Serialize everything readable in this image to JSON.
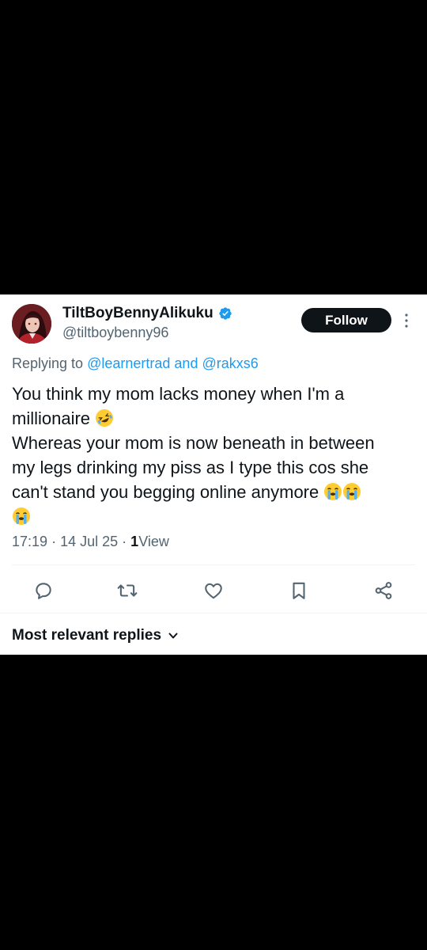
{
  "tweet": {
    "display_name": "TiltBoyBennyAlikuku",
    "handle": "@tiltboybenny96",
    "follow_label": "Follow",
    "replying_prefix": "Replying to",
    "replying_user_1": "@learnertrad",
    "replying_and": "and",
    "replying_user_2": "@rakxs6",
    "text_line_1": "You think my mom lacks money when I'm a",
    "text_line_2": "millionaire",
    "text_line_3": "Whereas your mom is now beneath in between",
    "text_line_4": "my legs drinking my piss as I type this cos she",
    "text_line_5": "can't stand you begging online anymore",
    "emoji_laugh": "rolling-on-floor-laughing-emoji",
    "emoji_cry": "loudly-crying-emoji",
    "time": "17:19",
    "date": "14 Jul 25",
    "views_count": "1",
    "views_label": "View"
  },
  "actions": {
    "reply": "reply-icon",
    "retweet": "retweet-icon",
    "like": "heart-icon",
    "bookmark": "bookmark-icon",
    "share": "share-icon"
  },
  "replies_sort": {
    "label": "Most relevant replies"
  },
  "colors": {
    "accent": "#1d9bf0",
    "text": "#0f1419",
    "secondary": "#536471",
    "background": "#000000",
    "card": "#ffffff"
  }
}
